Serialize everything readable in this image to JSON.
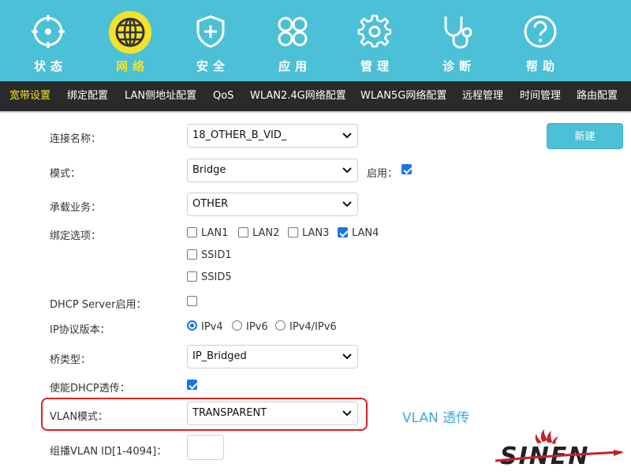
{
  "nav": {
    "items": [
      {
        "label": "状态",
        "icon": "status-target-icon"
      },
      {
        "label": "网络",
        "icon": "globe-icon",
        "active": true
      },
      {
        "label": "安全",
        "icon": "shield-plus-icon"
      },
      {
        "label": "应用",
        "icon": "apps-grid-icon"
      },
      {
        "label": "管理",
        "icon": "gear-icon"
      },
      {
        "label": "诊断",
        "icon": "stethoscope-icon"
      },
      {
        "label": "帮助",
        "icon": "help-question-icon"
      }
    ],
    "active_color": "#f4e227",
    "bar_color": "#4cc0d6"
  },
  "subnav": {
    "items": [
      "宽带设置",
      "绑定配置",
      "LAN侧地址配置",
      "QoS",
      "WLAN2.4G网络配置",
      "WLAN5G网络配置",
      "远程管理",
      "时间管理",
      "路由配置"
    ],
    "active_index": 0
  },
  "form": {
    "connection_name": {
      "label": "连接名称：",
      "value": "18_OTHER_B_VID_"
    },
    "mode": {
      "label": "模式：",
      "value": "Bridge",
      "enable_label": "启用：",
      "enabled": true
    },
    "service": {
      "label": "承载业务：",
      "value": "OTHER"
    },
    "binding": {
      "label": "绑定选项：",
      "options": [
        {
          "label": "LAN1",
          "checked": false
        },
        {
          "label": "LAN2",
          "checked": false
        },
        {
          "label": "LAN3",
          "checked": false
        },
        {
          "label": "LAN4",
          "checked": true
        },
        {
          "label": "SSID1",
          "checked": false
        },
        {
          "label": "SSID5",
          "checked": false
        }
      ]
    },
    "dhcp_server": {
      "label": "DHCP Server启用：",
      "checked": false
    },
    "ip_version": {
      "label": "IP协议版本：",
      "options": [
        "IPv4",
        "IPv6",
        "IPv4/IPv6"
      ],
      "selected": "IPv4"
    },
    "bridge_type": {
      "label": "桥类型：",
      "value": "IP_Bridged"
    },
    "dhcp_passthrough": {
      "label": "使能DHCP透传：",
      "checked": true
    },
    "vlan_mode": {
      "label": "VLAN模式：",
      "value": "TRANSPARENT"
    },
    "multicast_vlan": {
      "label": "组播VLAN ID[1-4094]：",
      "value": ""
    }
  },
  "buttons": {
    "new_label": "新建"
  },
  "annotation": {
    "text": "VLAN 透传",
    "color": "#3fa7d9"
  },
  "logo": {
    "text": "SINEN"
  }
}
